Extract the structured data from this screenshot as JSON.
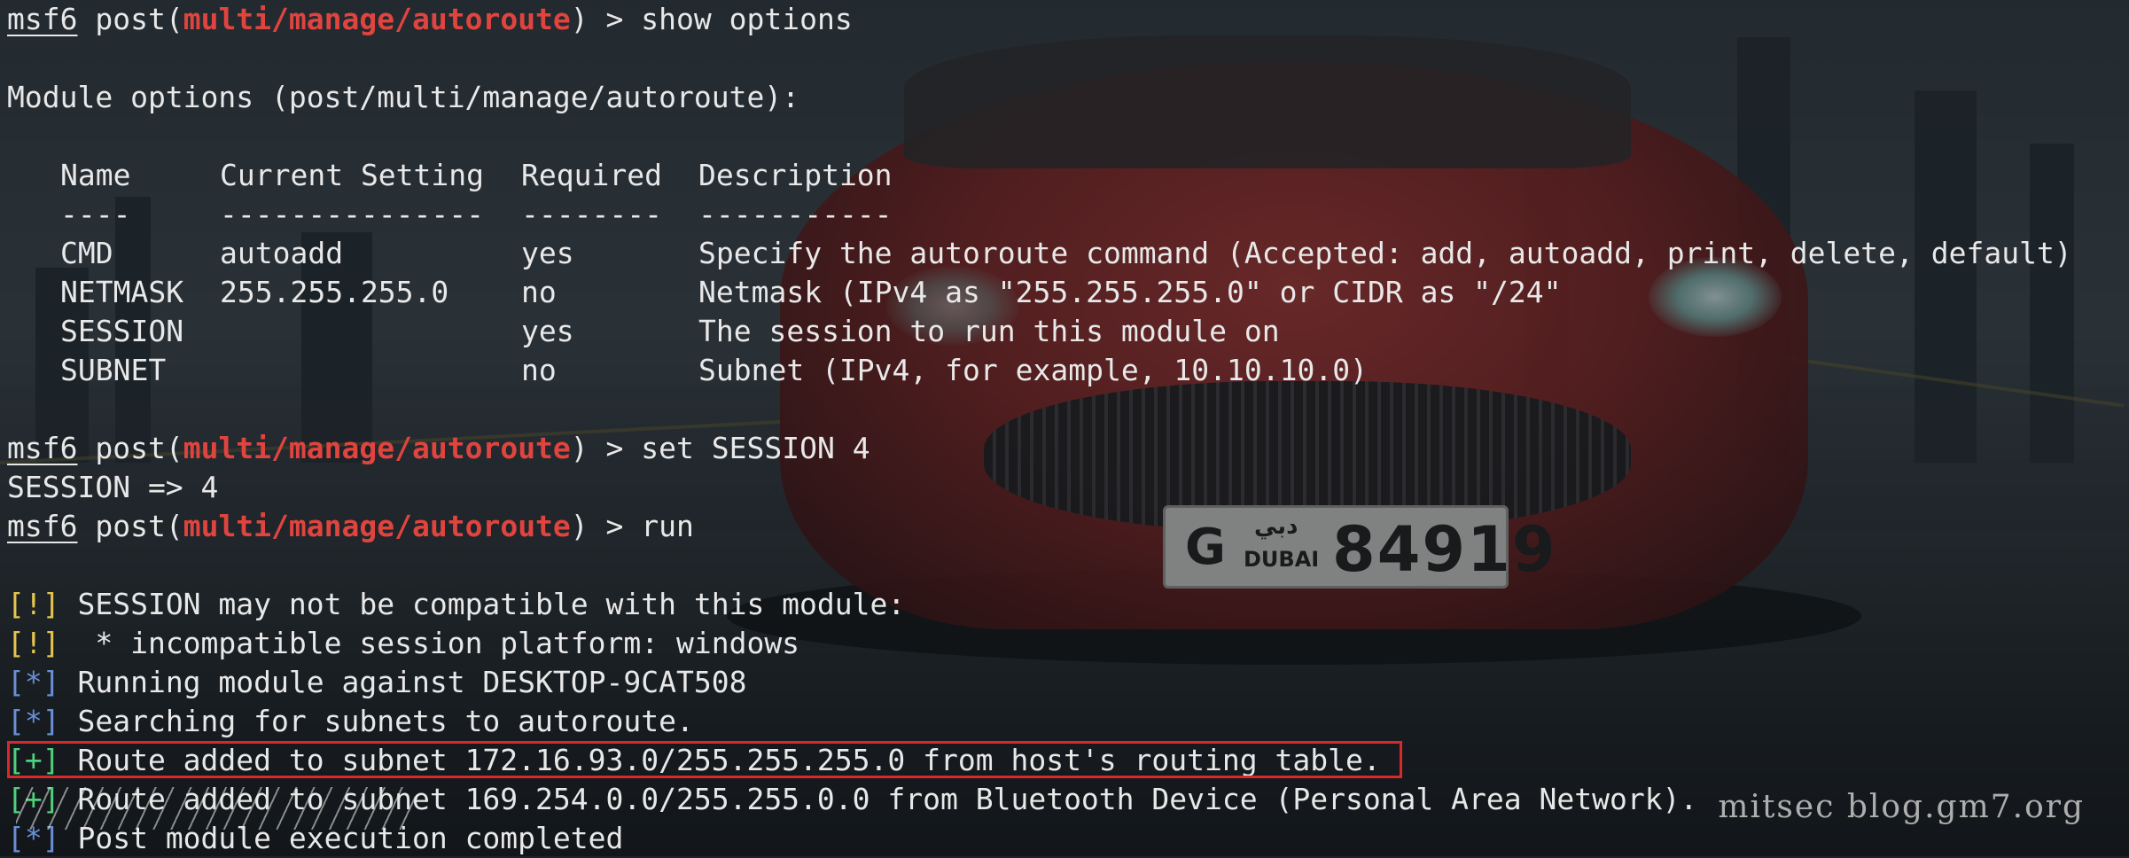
{
  "prompt": {
    "msf": "msf6",
    "post": " post(",
    "module": "multi/manage/autoroute",
    "close": ") > "
  },
  "commands": {
    "show": "show options",
    "set": "set SESSION 4",
    "run": "run"
  },
  "module_options_header": "Module options (post/multi/manage/autoroute):",
  "table": {
    "headers": [
      "Name",
      "Current Setting",
      "Required",
      "Description"
    ],
    "underlines": [
      "----",
      "---------------",
      "--------",
      "-----------"
    ],
    "rows": [
      [
        "CMD",
        "autoadd",
        "yes",
        "Specify the autoroute command (Accepted: add, autoadd, print, delete, default)"
      ],
      [
        "NETMASK",
        "255.255.255.0",
        "no",
        "Netmask (IPv4 as \"255.255.255.0\" or CIDR as \"/24\""
      ],
      [
        "SESSION",
        "",
        "yes",
        "The session to run this module on"
      ],
      [
        "SUBNET",
        "",
        "no",
        "Subnet (IPv4, for example, 10.10.10.0)"
      ]
    ]
  },
  "set_result": "SESSION => 4",
  "output": [
    {
      "tag": "[!]",
      "kind": "warn",
      "text": " SESSION may not be compatible with this module:"
    },
    {
      "tag": "[!]",
      "kind": "warn",
      "text": "  * incompatible session platform: windows"
    },
    {
      "tag": "[*]",
      "kind": "info",
      "text": " Running module against DESKTOP-9CAT508"
    },
    {
      "tag": "[*]",
      "kind": "info",
      "text": " Searching for subnets to autoroute."
    },
    {
      "tag": "[+]",
      "kind": "good",
      "text": " Route added to subnet 172.16.93.0/255.255.255.0 from host's routing table."
    },
    {
      "tag": "[+]",
      "kind": "good",
      "text": " Route added to subnet 169.254.0.0/255.255.0.0 from Bluetooth Device (Personal Area Network)."
    },
    {
      "tag": "[*]",
      "kind": "info",
      "text": " Post module execution completed"
    }
  ],
  "watermark": "mitsec blog.gm7.org",
  "plate": {
    "letter": "G",
    "arabic": "دبي",
    "city": "DUBAI",
    "number": "84919"
  },
  "colors": {
    "module": "#e0443e",
    "warn": "#e6c44e",
    "info": "#6a8fd6",
    "good": "#4fd07a",
    "highlight_box": "#d8282a"
  }
}
